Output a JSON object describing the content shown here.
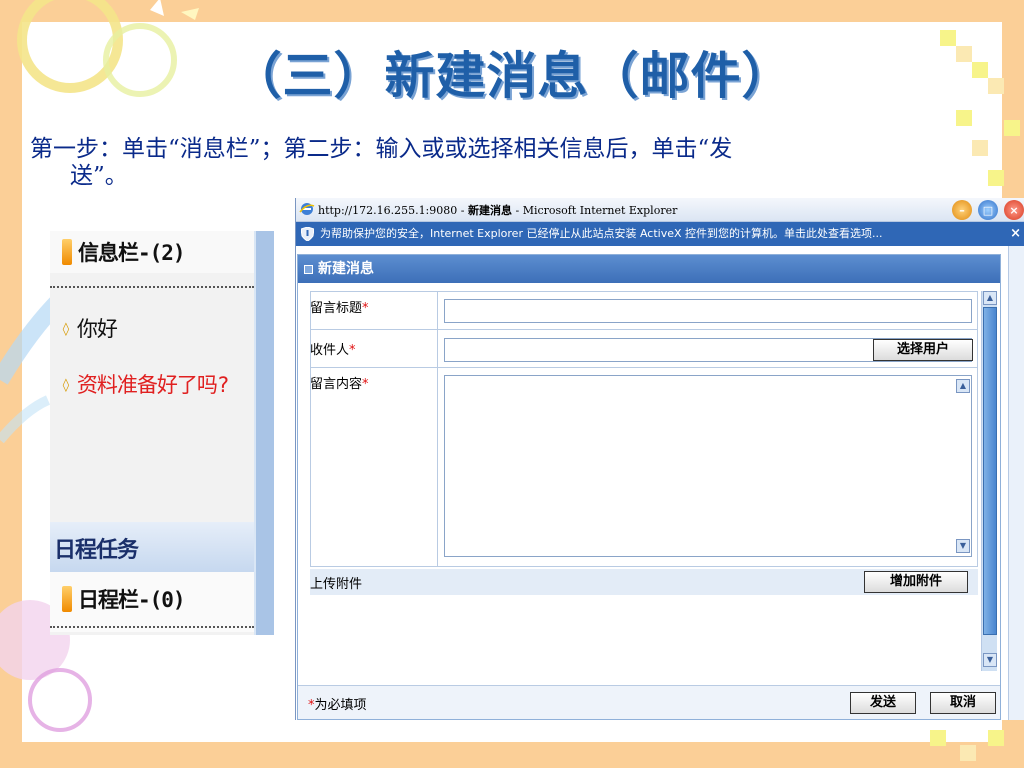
{
  "slide": {
    "title": "（三）新建消息（邮件）",
    "body_line1": "第一步：单击“消息栏”；第二步：输入或或选择相关信息后，单击“发",
    "body_line2": "送”。"
  },
  "left_panel": {
    "inbox_header": "信息栏-(2)",
    "messages": [
      {
        "text": "你好",
        "color": "#111111"
      },
      {
        "text": "资料准备好了吗?",
        "color": "#e02020"
      }
    ],
    "task_section": "日程任务",
    "schedule_header": "日程栏-(0)"
  },
  "browser": {
    "title_url": "http://172.16.255.1:9080 - ",
    "title_page": "新建消息",
    "title_app": " - Microsoft Internet Explorer",
    "infobar": "为帮助保护您的安全，Internet Explorer 已经停止从此站点安装 ActiveX 控件到您的计算机。单击此处查看选项...",
    "infobar_close": "×"
  },
  "form": {
    "header": "新建消息",
    "subject_label": "留言标题",
    "subject_value": "",
    "recipient_label": "收件人",
    "recipient_value": "",
    "select_user_button": "选择用户",
    "content_label": "留言内容",
    "content_value": "",
    "required_mark": "*",
    "attachment_label": "上传附件",
    "add_attachment_button": "增加附件",
    "required_note": "为必填项",
    "send_button": "发送",
    "cancel_button": "取消"
  },
  "colors": {
    "slide_background": "#fbcf97",
    "title_blue": "#1f5fa8",
    "form_header_blue": "#3d6fb8",
    "required_red": "#e01010"
  }
}
